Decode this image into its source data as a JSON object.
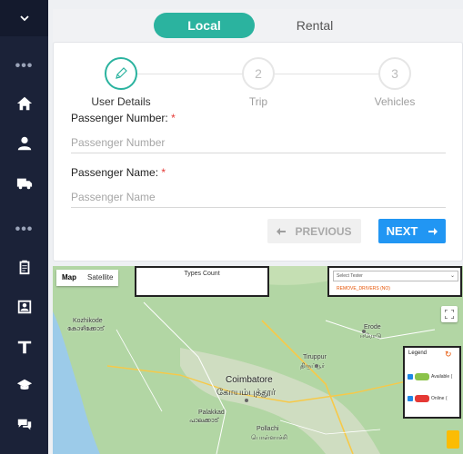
{
  "sidebar": {
    "items": [
      {
        "name": "menu-toggle",
        "icon": "chevron-down-icon"
      },
      {
        "name": "more-dots-1",
        "icon": "ellipsis-icon"
      },
      {
        "name": "home",
        "icon": "home-icon"
      },
      {
        "name": "profile",
        "icon": "user-icon"
      },
      {
        "name": "trips",
        "icon": "truck-icon"
      },
      {
        "name": "more-dots-2",
        "icon": "ellipsis-icon"
      },
      {
        "name": "bookings",
        "icon": "clipboard-icon"
      },
      {
        "name": "reports",
        "icon": "id-card-icon"
      },
      {
        "name": "tolls",
        "icon": "gate-icon"
      },
      {
        "name": "training",
        "icon": "graduation-cap-icon"
      },
      {
        "name": "chat",
        "icon": "chat-icon"
      }
    ],
    "dots": "•••"
  },
  "tabs": {
    "local": "Local",
    "rental": "Rental",
    "active": "local"
  },
  "steps": [
    {
      "number": "",
      "label": "User Details",
      "icon": "pencil-icon",
      "active": true
    },
    {
      "number": "2",
      "label": "Trip",
      "active": false
    },
    {
      "number": "3",
      "label": "Vehicles",
      "active": false
    }
  ],
  "form": {
    "passenger_number": {
      "label": "Passenger Number:",
      "required": "*",
      "placeholder": "Passenger Number",
      "value": ""
    },
    "passenger_name": {
      "label": "Passenger Name:",
      "required": "*",
      "placeholder": "Passenger Name",
      "value": ""
    }
  },
  "buttons": {
    "previous": "PREVIOUS",
    "next": "NEXT"
  },
  "map": {
    "map_type": {
      "map": "Map",
      "satellite": "Satellite",
      "selected": "Map"
    },
    "types_count": "Types Count",
    "tester": {
      "select_placeholder": "Select Tester",
      "remove_label": "REMOVE_DRIVERS (NO)"
    },
    "legend": {
      "title": "Legend",
      "items": [
        {
          "label": "Available (",
          "color": "#8bc34a"
        },
        {
          "label": "Online (",
          "color": "#e53935"
        }
      ]
    },
    "cities": [
      {
        "name": "Kozhikode",
        "local": "കോഴിക്കോട്"
      },
      {
        "name": "Coimbatore",
        "local": "கோயம்புத்தூர்"
      },
      {
        "name": "Erode",
        "local": "ஈரோடு"
      },
      {
        "name": "Tiruppur",
        "local": "திருப்பூர்"
      },
      {
        "name": "Palakkad",
        "local": "പാലക്കാട്"
      },
      {
        "name": "Pollachi",
        "local": "பொள்ளாச்சி"
      }
    ]
  },
  "colors": {
    "accent": "#2bb39f",
    "primary": "#2196f3",
    "sidebar": "#1b2238",
    "required": "#e53935"
  }
}
